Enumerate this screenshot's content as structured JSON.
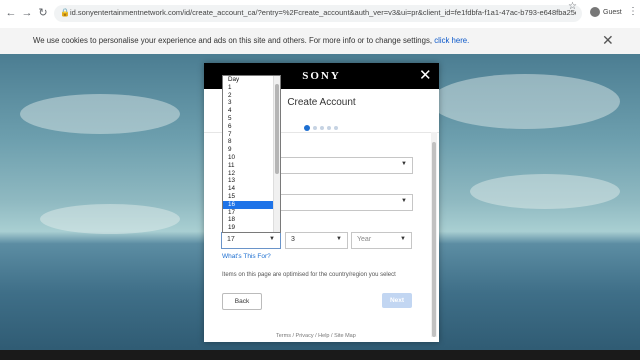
{
  "browser": {
    "url": "id.sonyentertainmentnetwork.com/id/create_account_ca/?entry=%2Fcreate_account&auth_ver=v3&ui=pr&client_id=fe1fdbfa-f1a1-47ac-b793-e648fba25e86&no_captcha=tr...",
    "profile_name": "Guest"
  },
  "cookie_banner": {
    "message": "We use cookies to personalise your experience and ads on this site and others. For more info or to change settings,",
    "link_text": "click here."
  },
  "modal": {
    "logo": "SONY",
    "title": "Create Account",
    "step_count": 5,
    "active_step": 1,
    "birthdate": {
      "day_value": "17",
      "month_value": "3",
      "year_placeholder": "Year"
    },
    "whats_this_link": "What's This For?",
    "note": "Items on this page are optimised for the country/region you select",
    "back_label": "Back",
    "next_label": "Next",
    "footer_links": "Terms / Privacy / Help / Site Map"
  },
  "day_dropdown": {
    "options": [
      "Day",
      "1",
      "2",
      "3",
      "4",
      "5",
      "6",
      "7",
      "8",
      "9",
      "10",
      "11",
      "12",
      "13",
      "14",
      "15",
      "16",
      "17",
      "18",
      "19"
    ],
    "highlighted": "16"
  },
  "colors": {
    "accent": "#1d6fd1",
    "highlight": "#1e73e8",
    "header": "#000000"
  }
}
